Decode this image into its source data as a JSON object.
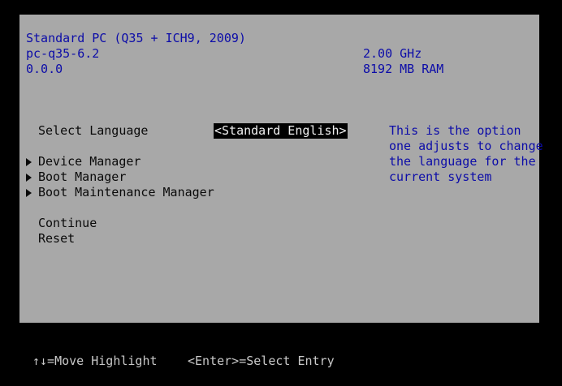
{
  "system_info": {
    "machine": "Standard PC (Q35 + ICH9, 2009)",
    "machine_type": "pc-q35-6.2",
    "version": "0.0.0",
    "cpu_speed": "2.00 GHz",
    "memory": "8192 MB RAM"
  },
  "menu": {
    "language_label": "Select Language",
    "language_value": "<Standard English>",
    "help_text": [
      "This is the option",
      "one adjusts to change",
      "the language for the",
      "current system"
    ],
    "submenus": [
      {
        "label": "Device Manager"
      },
      {
        "label": "Boot Manager"
      },
      {
        "label": "Boot Maintenance Manager"
      }
    ],
    "actions": [
      {
        "label": "Continue"
      },
      {
        "label": "Reset"
      }
    ]
  },
  "footer": {
    "move_hint": "↑↓=Move Highlight",
    "select_hint": "<Enter>=Select Entry"
  },
  "colors": {
    "panel_background": "#a8a8a8",
    "screen_background": "#000000",
    "header_text": "#0c0ca8",
    "menu_text": "#0a0a0a",
    "selection_background": "#000000",
    "selection_text": "#f0f0f0",
    "footer_text": "#c8c8c8"
  }
}
